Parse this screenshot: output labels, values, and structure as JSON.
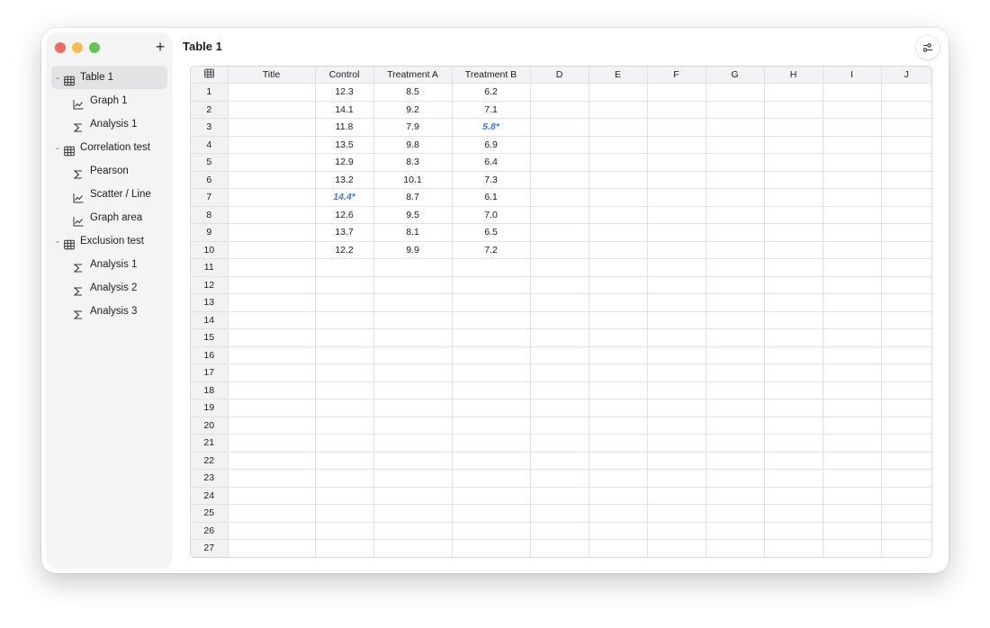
{
  "window": {
    "title": "Table 1"
  },
  "sidebar": {
    "add_label": "+",
    "items": [
      {
        "label": "Table 1",
        "icon": "table-icon",
        "level": 0,
        "expanded": true,
        "selected": true
      },
      {
        "label": "Graph 1",
        "icon": "graph-icon",
        "level": 1
      },
      {
        "label": "Analysis 1",
        "icon": "sigma-icon",
        "level": 1
      },
      {
        "label": "Correlation test",
        "icon": "table-icon",
        "level": 0,
        "expanded": true
      },
      {
        "label": "Pearson",
        "icon": "sigma-icon",
        "level": 1
      },
      {
        "label": "Scatter / Line",
        "icon": "graph-icon",
        "level": 1
      },
      {
        "label": "Graph area",
        "icon": "graph-icon",
        "level": 1
      },
      {
        "label": "Exclusion test",
        "icon": "table-icon",
        "level": 0,
        "expanded": true
      },
      {
        "label": "Analysis 1",
        "icon": "sigma-icon",
        "level": 1
      },
      {
        "label": "Analysis 2",
        "icon": "sigma-icon",
        "level": 1
      },
      {
        "label": "Analysis 3",
        "icon": "sigma-icon",
        "level": 1
      }
    ]
  },
  "table": {
    "columns": [
      "Title",
      "Control",
      "Treatment A",
      "Treatment B",
      "D",
      "E",
      "F",
      "G",
      "H",
      "I",
      "J"
    ],
    "total_rows": 27,
    "rows": [
      [
        "",
        "12.3",
        "8.5",
        "6.2"
      ],
      [
        "",
        "14.1",
        "9.2",
        "7.1"
      ],
      [
        "",
        "11.8",
        "7.9",
        "5.8*"
      ],
      [
        "",
        "13.5",
        "9.8",
        "6.9"
      ],
      [
        "",
        "12.9",
        "8.3",
        "6.4"
      ],
      [
        "",
        "13.2",
        "10.1",
        "7.3"
      ],
      [
        "",
        "14.4*",
        "8.7",
        "6.1"
      ],
      [
        "",
        "12.6",
        "9.5",
        "7.0"
      ],
      [
        "",
        "13.7",
        "8.1",
        "6.5"
      ],
      [
        "",
        "12.2",
        "9.9",
        "7.2"
      ]
    ],
    "excluded_color": "#3b7fd4"
  },
  "colors": {
    "accent": "#3b7fd4",
    "close": "#ed6a5e",
    "minimize": "#f5bf4f",
    "zoom": "#61c554"
  }
}
